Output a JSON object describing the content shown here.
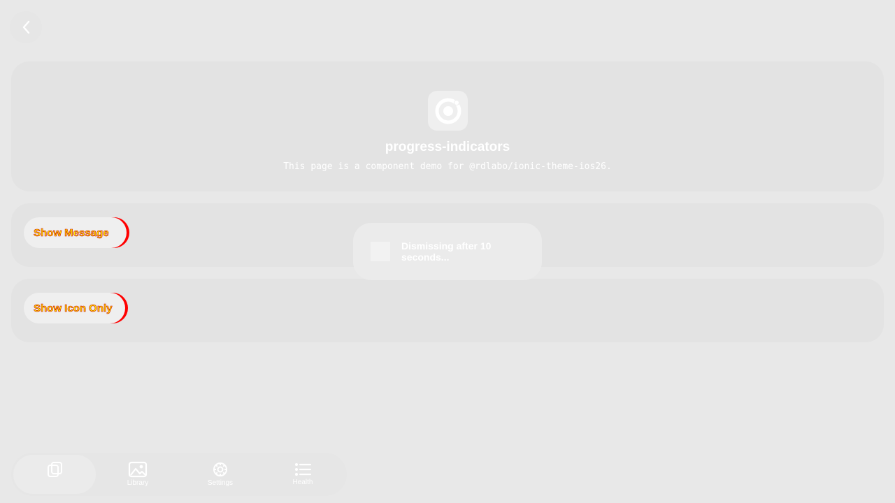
{
  "header": {
    "back_icon": "chevron-left-icon"
  },
  "hero": {
    "logo_icon": "ionic-logo-icon",
    "title": "progress-indicators",
    "subtitle": "This page is a component demo for @rdlabo/ionic-theme-ios26."
  },
  "buttons": {
    "show_message": "Show Message",
    "show_icon_only": "Show Icon Only"
  },
  "toast": {
    "spinner_icon": "loading-spinner-icon",
    "message": "Dismissing after 10 seconds..."
  },
  "tabbar": {
    "tabs": [
      {
        "label": "",
        "icon": "stack-icon",
        "active": true
      },
      {
        "label": "Library",
        "icon": "photos-icon",
        "active": false
      },
      {
        "label": "Settings",
        "icon": "gear-icon",
        "active": false
      },
      {
        "label": "Health",
        "icon": "list-icon",
        "active": false
      }
    ]
  },
  "colors": {
    "background": "#e8e8e8",
    "card": "#e3e3e3",
    "button_text": "#ffee00",
    "button_accent": "#ff0000"
  }
}
